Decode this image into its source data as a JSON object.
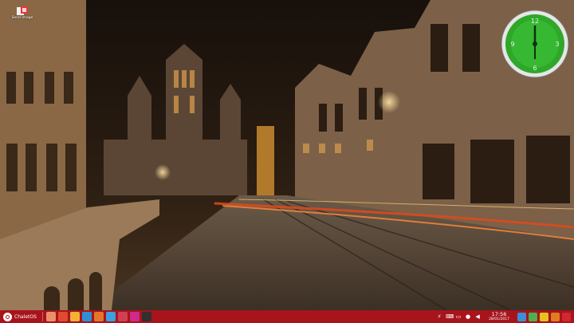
{
  "desktop": {
    "icons": [
      {
        "label": "Send Image",
        "icon": "image-share-icon"
      }
    ],
    "clock_widget": {
      "hour_labels": [
        "12",
        "3",
        "6",
        "9"
      ],
      "face_color": "#2fa82a"
    }
  },
  "taskbar": {
    "color": "#a8141c",
    "menu_label": "ChaletOS",
    "launchers": [
      {
        "name": "file-manager-icon",
        "color": "#e8906a"
      },
      {
        "name": "chrome-icon",
        "color": "#e04a2e"
      },
      {
        "name": "photos-icon",
        "color": "#f2b233"
      },
      {
        "name": "globe-icon",
        "color": "#2f8fd6"
      },
      {
        "name": "firefox-icon",
        "color": "#e0772a"
      },
      {
        "name": "software-center-icon",
        "color": "#3aa0e0"
      },
      {
        "name": "app-grid-icon",
        "color": "#d04050"
      },
      {
        "name": "settings-icon",
        "color": "#cf2a8a"
      },
      {
        "name": "terminal-icon",
        "color": "#303030"
      }
    ],
    "tray_icons": [
      "lightning-icon",
      "keyboard-icon",
      "battery-icon",
      "record-icon",
      "volume-icon"
    ],
    "clock": {
      "time": "17:56",
      "date": "28/01/2017"
    },
    "system_buttons": [
      {
        "name": "show-desktop-icon",
        "color": "#3a8fd6"
      },
      {
        "name": "workspace-icon",
        "color": "#4caf50"
      },
      {
        "name": "notes-icon",
        "color": "#e6c21f"
      },
      {
        "name": "lock-icon",
        "color": "#e07d20"
      },
      {
        "name": "power-icon",
        "color": "#d22630"
      }
    ]
  }
}
